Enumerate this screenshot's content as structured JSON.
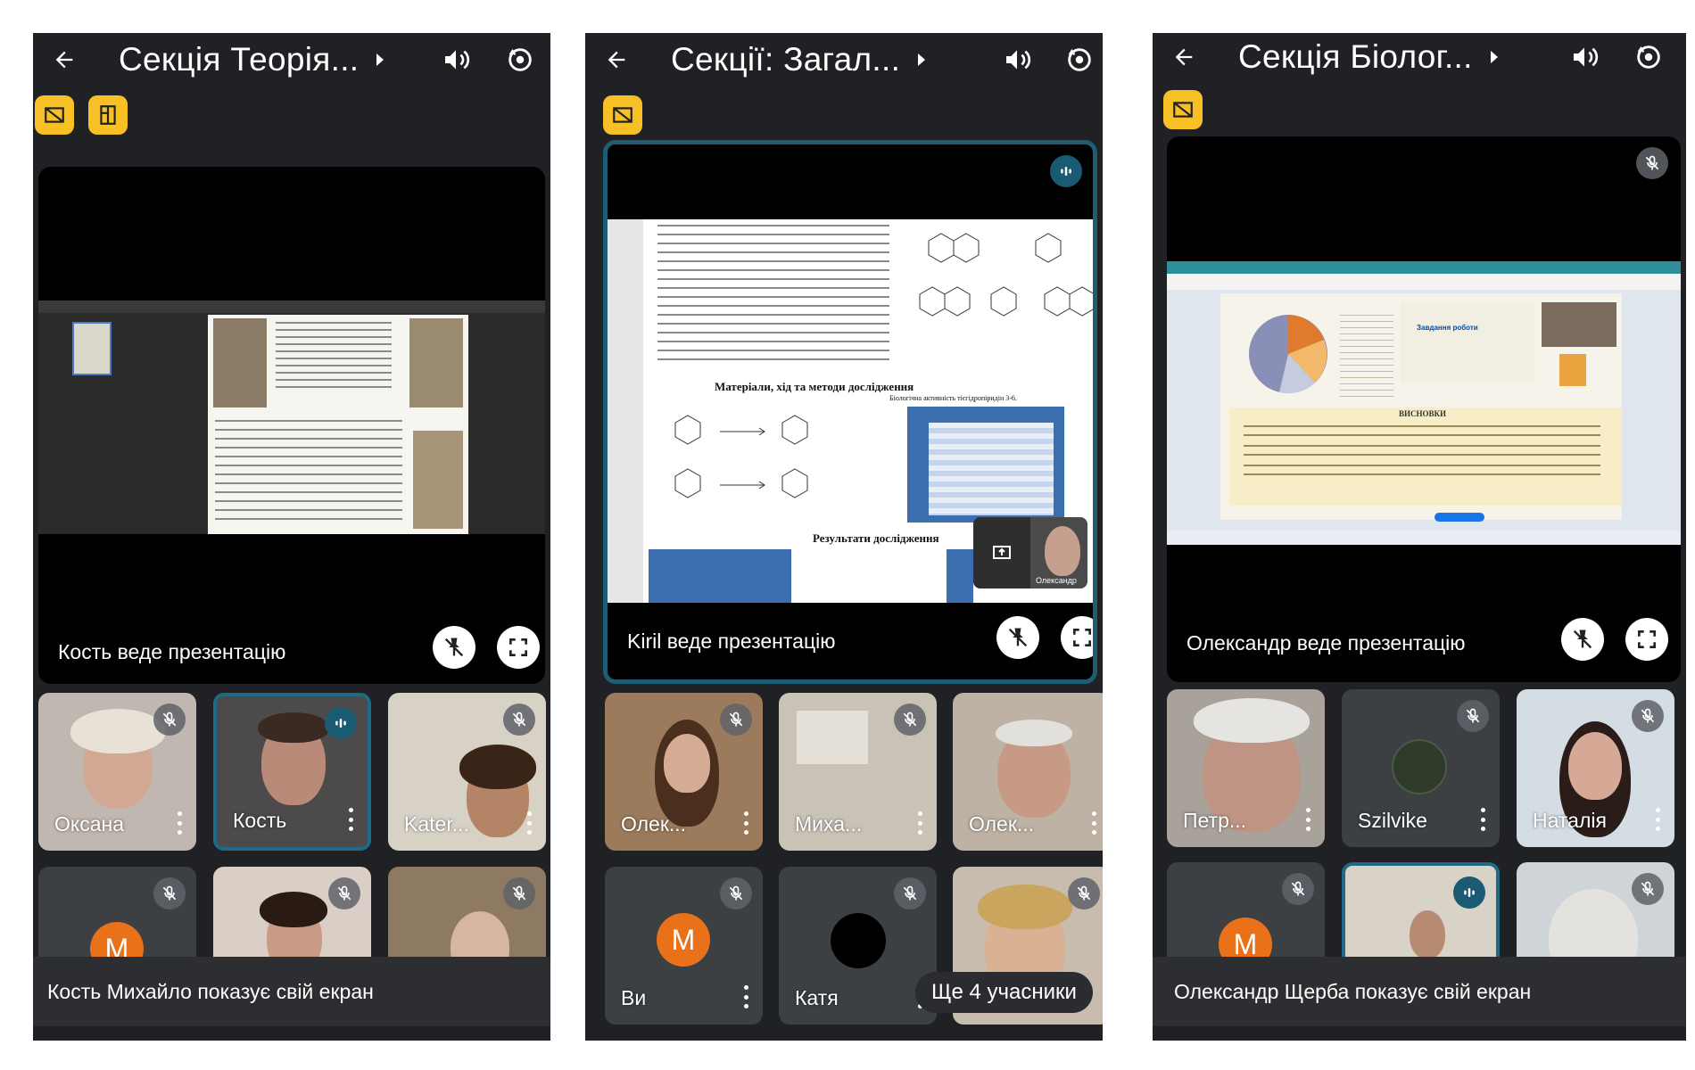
{
  "panels": [
    {
      "title": "Секція Теорія...",
      "presenter_label": "Кость веде презентацію",
      "tiles": [
        {
          "name": "Оксана"
        },
        {
          "name": "Кость"
        },
        {
          "name": "Kater..."
        },
        {
          "name": "",
          "avatar": "M"
        },
        {
          "name": ""
        },
        {
          "name": ""
        }
      ],
      "share_banner": "Кость Михайло показує свій екран"
    },
    {
      "title": "Секції: Загал...",
      "presenter_label": "Kiril веде презентацію",
      "slide": {
        "heading1": "Матеріали, хід та методи дослідження",
        "heading2": "Результати дослідження",
        "right_caption": "Біологічна активність тієгідропіридін 3-6.",
        "pip_name": "Олександр"
      },
      "tiles": [
        {
          "name": "Олек..."
        },
        {
          "name": "Миха..."
        },
        {
          "name": "Олек..."
        },
        {
          "name": "Ви",
          "avatar": "M"
        },
        {
          "name": "Катя"
        },
        {
          "name": ""
        }
      ],
      "more_label": "Ще 4 учасники"
    },
    {
      "title": "Секція Біолог...",
      "presenter_label": "Олександр веде презентацію",
      "slide": {
        "task_title": "Завдання роботи",
        "conclusions_title": "ВИСНОВКИ"
      },
      "tiles": [
        {
          "name": "Петр..."
        },
        {
          "name": "Szilvike"
        },
        {
          "name": "Наталія"
        },
        {
          "name": "",
          "avatar": "M"
        },
        {
          "name": ""
        },
        {
          "name": ""
        }
      ],
      "share_banner": "Олександр Щерба показує свій екран"
    }
  ],
  "colors": {
    "background": "#202124",
    "badge": "#f6c026",
    "speaking": "#1f5d72",
    "avatar": "#e8711a"
  },
  "icons": [
    "back-arrow-icon",
    "speaker-icon",
    "switch-camera-icon",
    "no-video-icon",
    "layout-icon",
    "mic-off-icon",
    "fullscreen-icon",
    "unpin-icon",
    "more-vert-icon",
    "speaking-icon"
  ]
}
